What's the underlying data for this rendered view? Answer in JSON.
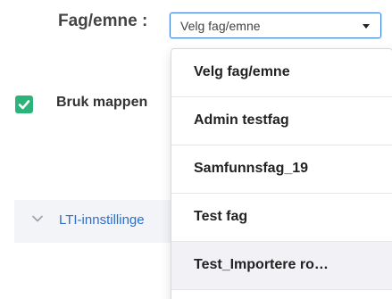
{
  "subject": {
    "label": "Fag/emne :",
    "selected_value": "Velg fag/emne",
    "options": [
      "Velg fag/emne",
      "Admin testfag",
      "Samfunnsfag_19",
      "Test fag",
      "Test_Importere ro…"
    ],
    "highlighted_option": "Test_Importere ro…"
  },
  "folder_checkbox": {
    "label": "Bruk mappen",
    "checked": true
  },
  "lti_settings": {
    "label": "LTI-innstillinge"
  },
  "colors": {
    "checkbox": "#2bb37a",
    "link": "#2c6fcb",
    "select_border": "#3b7ddd",
    "highlight_row": "#f2f1f5",
    "panel_background": "#f3f4f7"
  },
  "icons": {
    "checkbox": "checkmark-icon",
    "select_caret": "caret-down-icon",
    "lti_toggle": "chevron-down-icon"
  }
}
